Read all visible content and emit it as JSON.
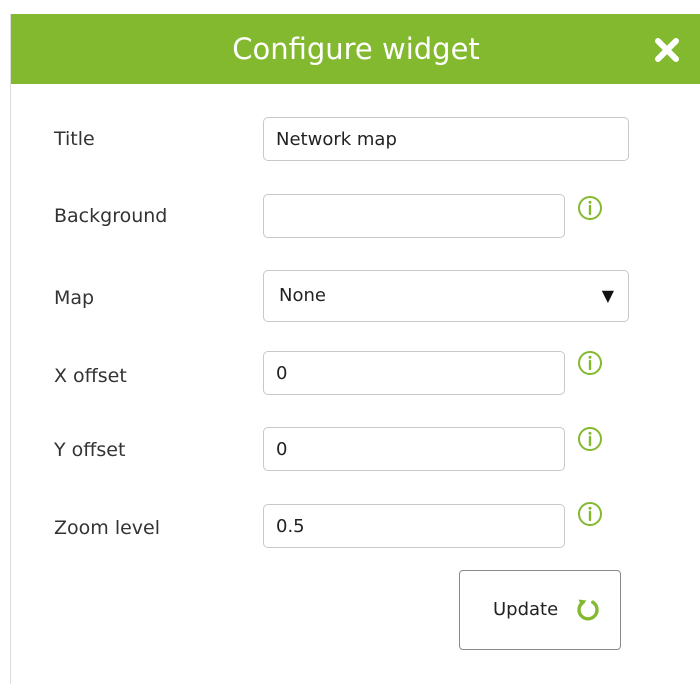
{
  "dialog": {
    "title": "Configure widget",
    "close_icon": "close-icon"
  },
  "fields": {
    "title": {
      "label": "Title",
      "value": "Network map"
    },
    "background": {
      "label": "Background",
      "value": "",
      "info_icon": "info-icon"
    },
    "map": {
      "label": "Map",
      "selected": "None"
    },
    "x_offset": {
      "label": "X offset",
      "value": "0",
      "info_icon": "info-icon"
    },
    "y_offset": {
      "label": "Y offset",
      "value": "0",
      "info_icon": "info-icon"
    },
    "zoom_level": {
      "label": "Zoom level",
      "value": "0.5",
      "info_icon": "info-icon"
    }
  },
  "actions": {
    "update_label": "Update",
    "update_icon": "refresh-icon"
  },
  "colors": {
    "accent": "#82b92e",
    "info_icon": "#82b92e",
    "border": "#c8c8c8",
    "text": "#333333"
  }
}
